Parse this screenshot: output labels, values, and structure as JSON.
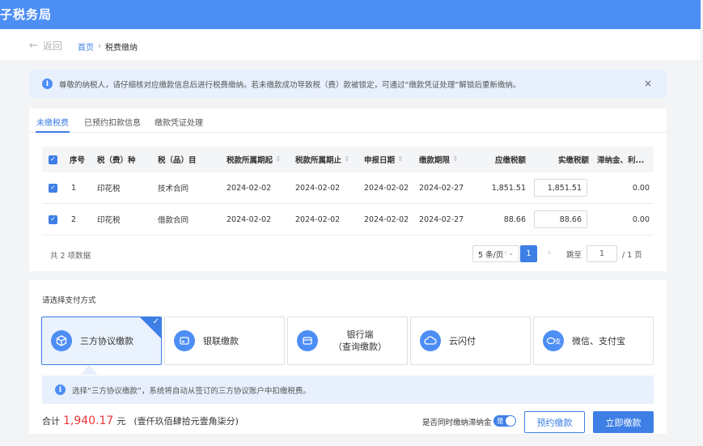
{
  "app": {
    "title": "子税务局"
  },
  "nav": {
    "back_label": "返回",
    "breadcrumb_home": "首页",
    "breadcrumb_sep": "›",
    "breadcrumb_current": "税费缴纳"
  },
  "notice": {
    "icon": "info-icon",
    "text": "尊敬的纳税人，请仔细核对应缴款信息后进行税费缴纳。若未缴款成功导致税（费）款被锁定，可通过“缴款凭证处理”解锁后重新缴纳。",
    "close": "×"
  },
  "tabs": [
    {
      "label": "未缴税费",
      "active": true
    },
    {
      "label": "已预约扣款信息",
      "active": false
    },
    {
      "label": "缴款凭证处理",
      "active": false
    }
  ],
  "table": {
    "headers": {
      "seq": "序号",
      "tax_type": "税（费）种",
      "tax_item": "税（品）目",
      "period_start": "税款所属期起",
      "period_end": "税款所属期止",
      "declare_date": "申报日期",
      "deadline": "缴款期限",
      "due": "应缴税额",
      "actual": "实缴税额",
      "late": "滞纳金、利..."
    },
    "sort_glyph": "⇕",
    "check_glyph": "✓",
    "rows": [
      {
        "seq": "1",
        "tax_type": "印花税",
        "tax_item": "技术合同",
        "period_start": "2024-02-02",
        "period_end": "2024-02-02",
        "declare_date": "2024-02-02",
        "deadline": "2024-02-27",
        "due": "1,851.51",
        "actual": "1,851.51",
        "late": "0.00"
      },
      {
        "seq": "2",
        "tax_type": "印花税",
        "tax_item": "借款合同",
        "period_start": "2024-02-02",
        "period_end": "2024-02-02",
        "declare_date": "2024-02-02",
        "deadline": "2024-02-27",
        "due": "88.66",
        "actual": "88.66",
        "late": "0.00"
      }
    ]
  },
  "pager": {
    "total": "共 2 项数据",
    "page_size": "5 条/页",
    "prev": "‹",
    "current": "1",
    "next": "›",
    "jump_label": "跳至",
    "jump_value": "1",
    "total_pages": "/ 1 页"
  },
  "payment": {
    "heading": "请选择支付方式",
    "methods": [
      {
        "label": "三方协议缴款",
        "icon": "cube-icon",
        "selected": true
      },
      {
        "label": "银联缴款",
        "icon": "card-icon",
        "selected": false
      },
      {
        "label_line1": "银行端",
        "label_line2": "（查询缴款）",
        "icon": "bank-card-icon",
        "selected": false
      },
      {
        "label": "云闪付",
        "icon": "cloud-icon",
        "selected": false
      },
      {
        "label": "微信、支付宝",
        "icon": "wechat-alipay-icon",
        "selected": false
      }
    ],
    "notice": "选择“三方协议缴款”，系统将自动从签订的三方协议账户中扣缴税费。"
  },
  "footer": {
    "total_label": "合计",
    "total_amount": "1,940.17",
    "total_unit": "元",
    "total_words": "(壹仟玖佰肆拾元壹角柒分)",
    "toggle_label": "是否同时缴纳滞纳金",
    "toggle_text": "是",
    "toggle_on": true,
    "book_button": "预约缴款",
    "pay_button": "立即缴款"
  },
  "colors": {
    "brand": "#4d8ef5",
    "primary": "#3e7fe6",
    "amount": "#e8383a",
    "notice_bg": "#e7f0fc"
  }
}
